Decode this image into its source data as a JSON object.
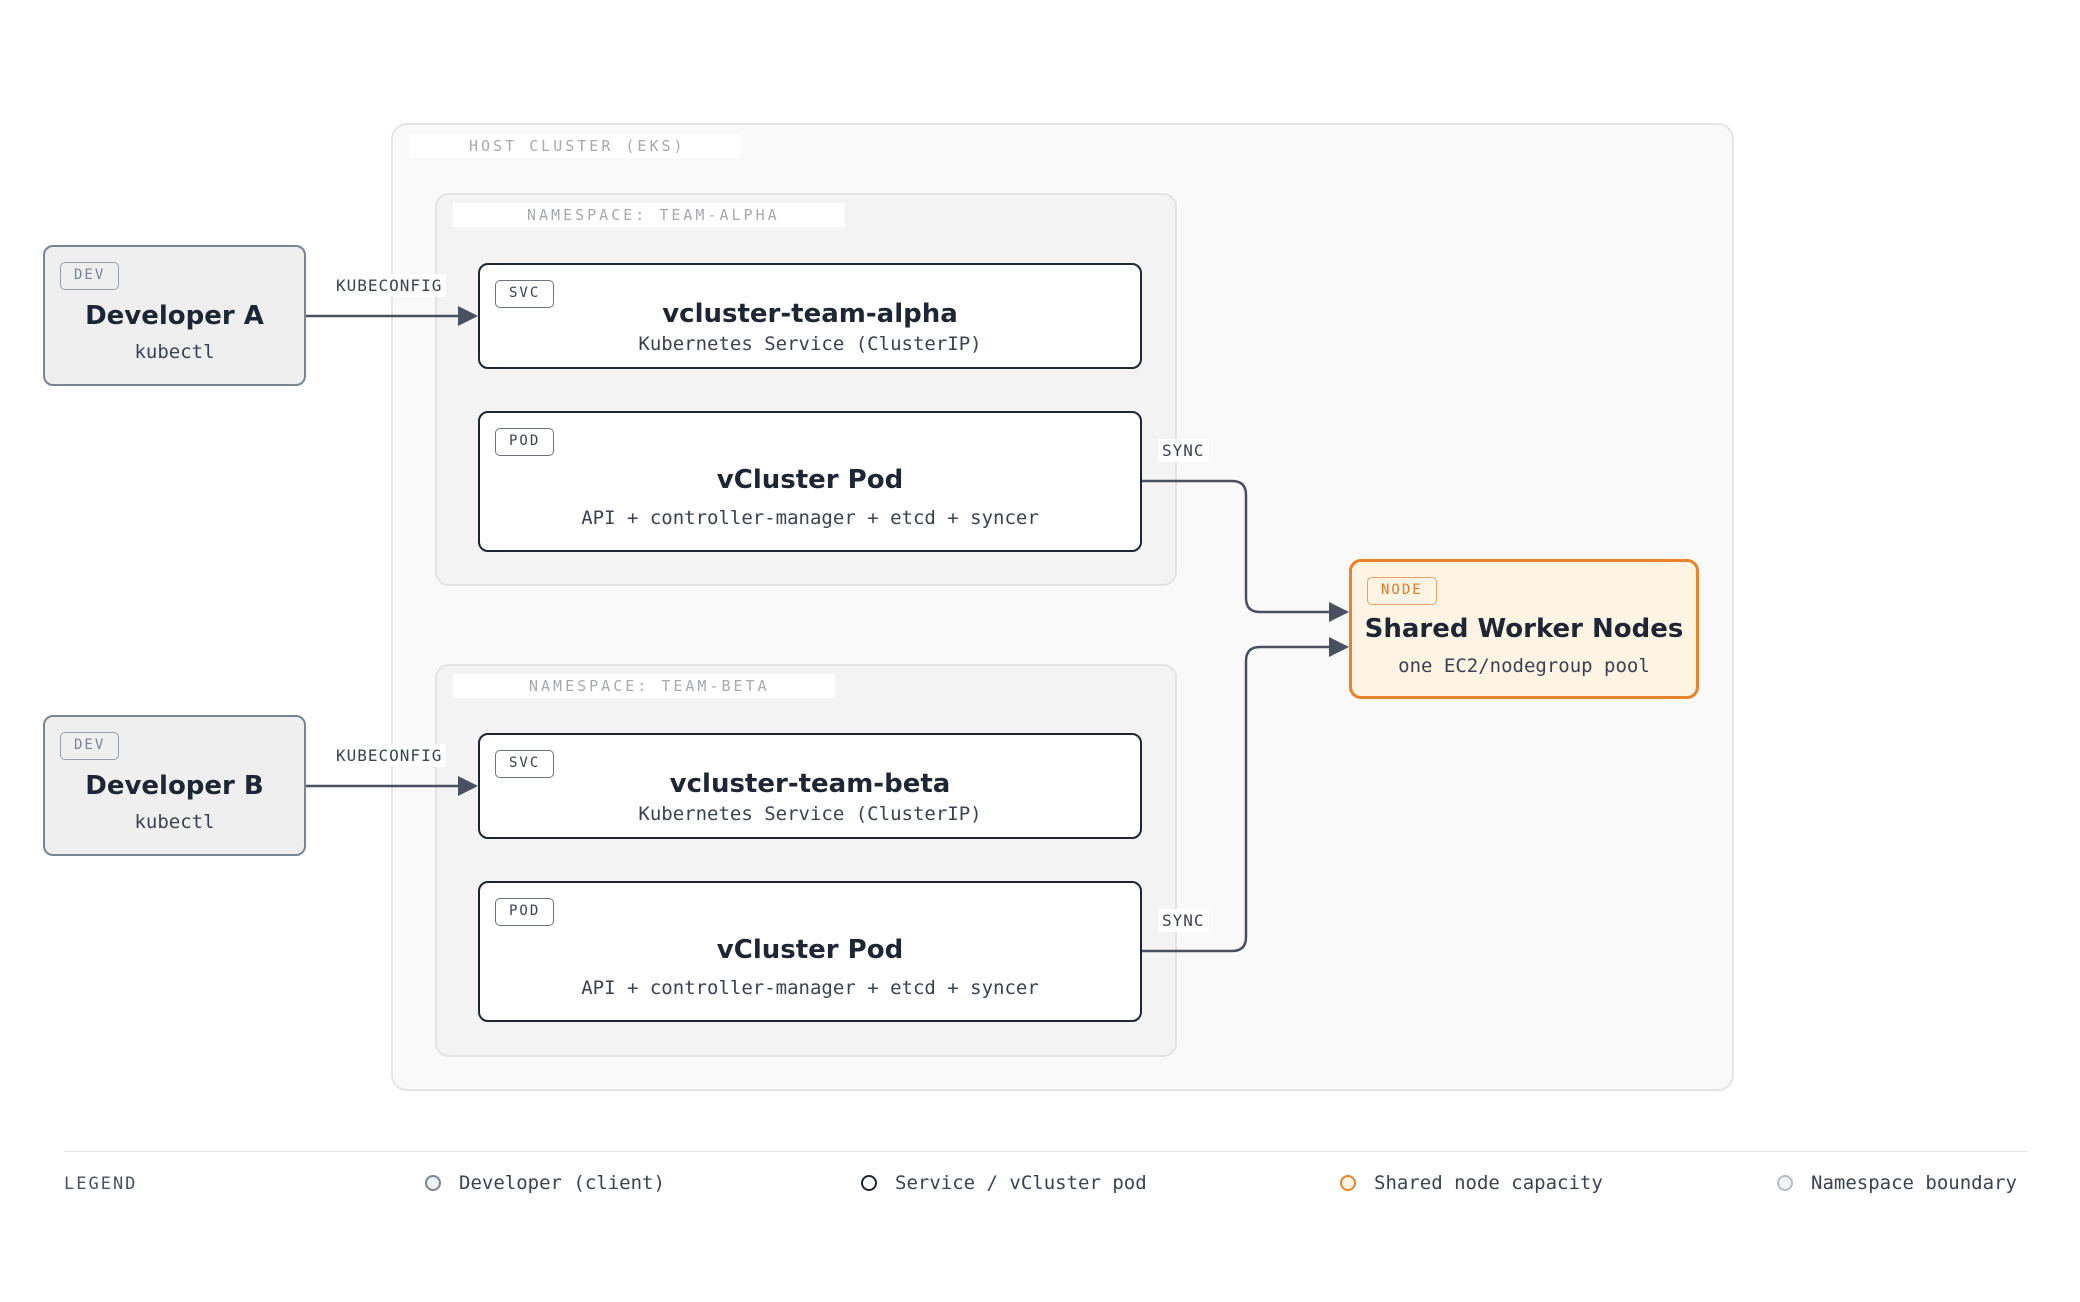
{
  "host_cluster": {
    "label": "HOST CLUSTER (EKS)"
  },
  "namespaces": [
    {
      "label": "NAMESPACE: TEAM-ALPHA",
      "service": {
        "badge": "SVC",
        "title": "vcluster-team-alpha",
        "subtitle": "Kubernetes Service (ClusterIP)"
      },
      "pod": {
        "badge": "POD",
        "title": "vCluster Pod",
        "subtitle": "API + controller-manager + etcd + syncer"
      }
    },
    {
      "label": "NAMESPACE: TEAM-BETA",
      "service": {
        "badge": "SVC",
        "title": "vcluster-team-beta",
        "subtitle": "Kubernetes Service (ClusterIP)"
      },
      "pod": {
        "badge": "POD",
        "title": "vCluster Pod",
        "subtitle": "API + controller-manager + etcd + syncer"
      }
    }
  ],
  "developers": [
    {
      "badge": "DEV",
      "name": "Developer A",
      "tool": "kubectl"
    },
    {
      "badge": "DEV",
      "name": "Developer B",
      "tool": "kubectl"
    }
  ],
  "shared_nodes": {
    "badge": "NODE",
    "title": "Shared Worker Nodes",
    "subtitle": "one EC2/nodegroup pool"
  },
  "edges": {
    "kubeconfig_label": "KUBECONFIG",
    "sync_label": "SYNC"
  },
  "legend": {
    "title": "LEGEND",
    "items": [
      {
        "label": "Developer (client)",
        "color": "#7a8594"
      },
      {
        "label": "Service / vCluster pod",
        "color": "#1e2533"
      },
      {
        "label": "Shared node capacity",
        "color": "#e8822a"
      },
      {
        "label": "Namespace boundary",
        "color": "#b8bcc2"
      }
    ]
  },
  "colors": {
    "node_border": "#1e2533",
    "developer_border": "#7a8594",
    "shared_accent": "#e8822a",
    "shared_fill": "#fdf4e4",
    "edge": "#4a5060"
  }
}
